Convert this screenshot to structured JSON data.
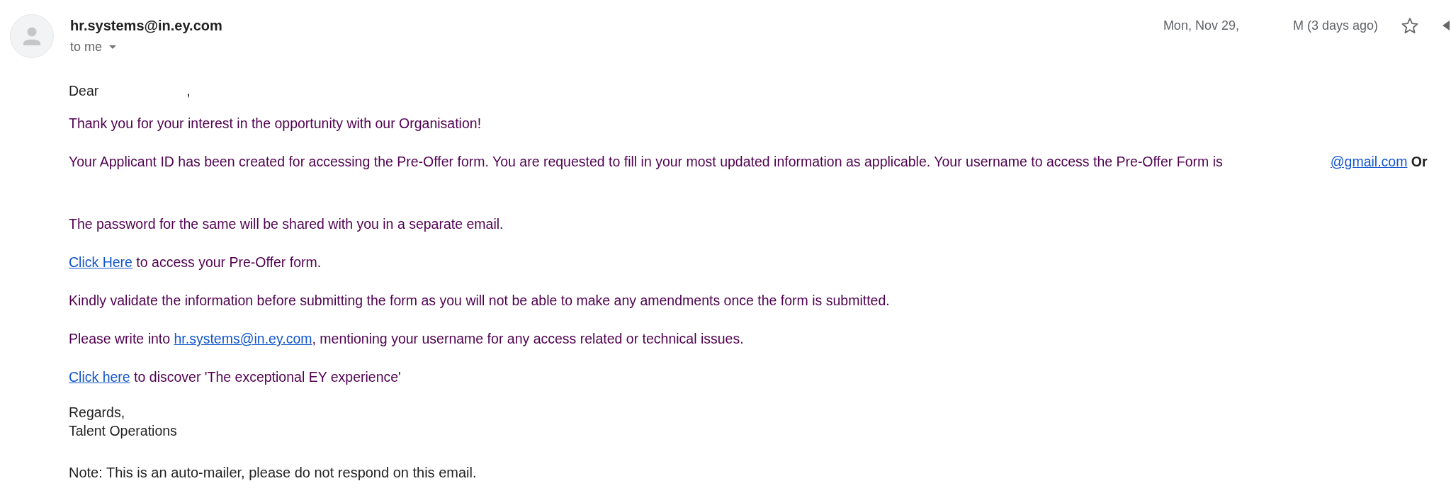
{
  "message": {
    "sender": "hr.systems@in.ey.com",
    "recipient": "to me",
    "date": "Mon, Nov 29,",
    "time": "M (3 days ago)",
    "starred": false
  },
  "body": {
    "greeting": "Dear",
    "greeting_end": ",",
    "paragraphs": [
      {
        "kind": "plain",
        "parts": [
          {
            "kind": "text",
            "text": "Thank you for your interest in the opportunity with our Organisation!"
          }
        ]
      },
      {
        "kind": "redacted",
        "parts": [
          {
            "kind": "text",
            "text": "Your Applicant ID has been created for accessing the Pre-Offer form. You are requested to fill in your most updated information as applicable. Your username to access the Pre-Offer Form is"
          },
          {
            "kind": "link",
            "text": "@gmail.com"
          },
          {
            "kind": "text",
            "text": " **Or**"
          }
        ]
      },
      {
        "kind": "plain",
        "parts": [
          {
            "kind": "text",
            "text": "The password for the same will be shared with you in a separate email."
          }
        ]
      },
      {
        "kind": "plain",
        "parts": [
          {
            "kind": "link",
            "text": "Click Here"
          },
          {
            "kind": "text",
            "text": " to access your Pre-Offer form."
          }
        ]
      },
      {
        "kind": "plain",
        "parts": [
          {
            "kind": "text",
            "text": "Kindly validate the information before submitting the form as you will not be able to make any amendments once the form is submitted."
          }
        ]
      },
      {
        "kind": "plain",
        "parts": [
          {
            "kind": "text",
            "text": "Please write into "
          },
          {
            "kind": "link",
            "text": "hr.systems@in.ey.com"
          },
          {
            "kind": "text",
            "text": ", mentioning your username for any access related or technical issues."
          }
        ]
      },
      {
        "kind": "plain",
        "parts": [
          {
            "kind": "link",
            "text": "Click here"
          },
          {
            "kind": "text",
            "text": " to discover 'The exceptional EY experience'"
          }
        ]
      }
    ],
    "signoff": "Regards,",
    "signature": "Talent Operations",
    "note": "Note: This is an auto-mailer, please do not respond on this email."
  }
}
